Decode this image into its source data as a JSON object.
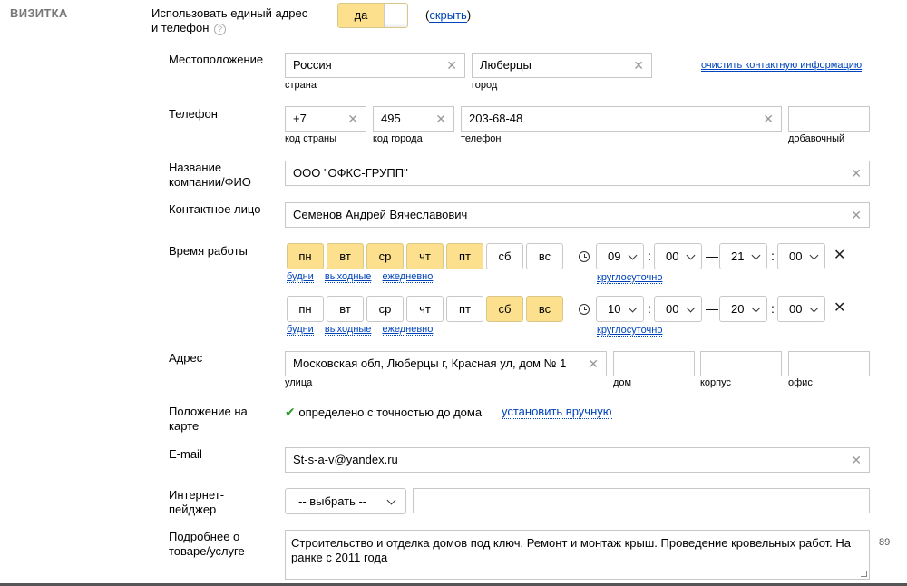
{
  "section": {
    "title": "ВИЗИТКА"
  },
  "unified": {
    "label_line1": "Использовать единый адрес",
    "label_line2": "и телефон",
    "help": "?",
    "toggle_on": "да",
    "hide_link": "скрыть",
    "hide_prefix": "(",
    "hide_suffix": ")"
  },
  "location": {
    "label": "Местоположение",
    "country_value": "Россия",
    "country_hint": "страна",
    "city_value": "Люберцы",
    "city_hint": "город",
    "clear_link": "очистить контактную информацию"
  },
  "phone": {
    "label": "Телефон",
    "country_code": "+7",
    "country_code_hint": "код страны",
    "city_code": "495",
    "city_code_hint": "код города",
    "number": "203-68-48",
    "number_hint": "телефон",
    "ext": "",
    "ext_hint": "добавочный"
  },
  "company": {
    "label_line1": "Название",
    "label_line2": "компании/ФИО",
    "value": "ООО \"ОФКС-ГРУПП\""
  },
  "contact": {
    "label": "Контактное лицо",
    "value": "Семенов Андрей Вячеславович"
  },
  "hours": {
    "label": "Время работы",
    "days": [
      "пн",
      "вт",
      "ср",
      "чт",
      "пт",
      "сб",
      "вс"
    ],
    "presets": {
      "weekdays": "будни",
      "weekend": "выходные",
      "daily": "ежедневно",
      "allday": "круглосуточно"
    },
    "rows": [
      {
        "active": [
          true,
          true,
          true,
          true,
          true,
          false,
          false
        ],
        "from_h": "09",
        "from_m": "00",
        "to_h": "21",
        "to_m": "00"
      },
      {
        "active": [
          false,
          false,
          false,
          false,
          false,
          true,
          true
        ],
        "from_h": "10",
        "from_m": "00",
        "to_h": "20",
        "to_m": "00"
      }
    ],
    "colon": ":",
    "dash": "—",
    "delete": "✕"
  },
  "address": {
    "label": "Адрес",
    "street_value": "Московская обл, Люберцы г, Красная ул, дом № 1",
    "street_hint": "улица",
    "house_hint": "дом",
    "building_hint": "корпус",
    "office_hint": "офис"
  },
  "map": {
    "label_line1": "Положение на",
    "label_line2": "карте",
    "status": "определено с точностью до дома",
    "set_manual": "установить вручную"
  },
  "email": {
    "label": "E-mail",
    "value": "St-s-a-v@yandex.ru"
  },
  "pager": {
    "label_line1": "Интернет-",
    "label_line2": "пейджер",
    "select_value": "-- выбрать --"
  },
  "details": {
    "label_line1": "Подробнее о",
    "label_line2": "товаре/услуге",
    "value": "Строительство и отделка домов под ключ. Ремонт и монтаж крыш. Проведение кровельных работ. На ранке с 2011 года",
    "counter": "89"
  },
  "colors": {
    "accent_yellow": "#fde08d",
    "link_blue": "#0044bb",
    "border": "#c8c8c8",
    "check_green": "#2a9a2a"
  }
}
